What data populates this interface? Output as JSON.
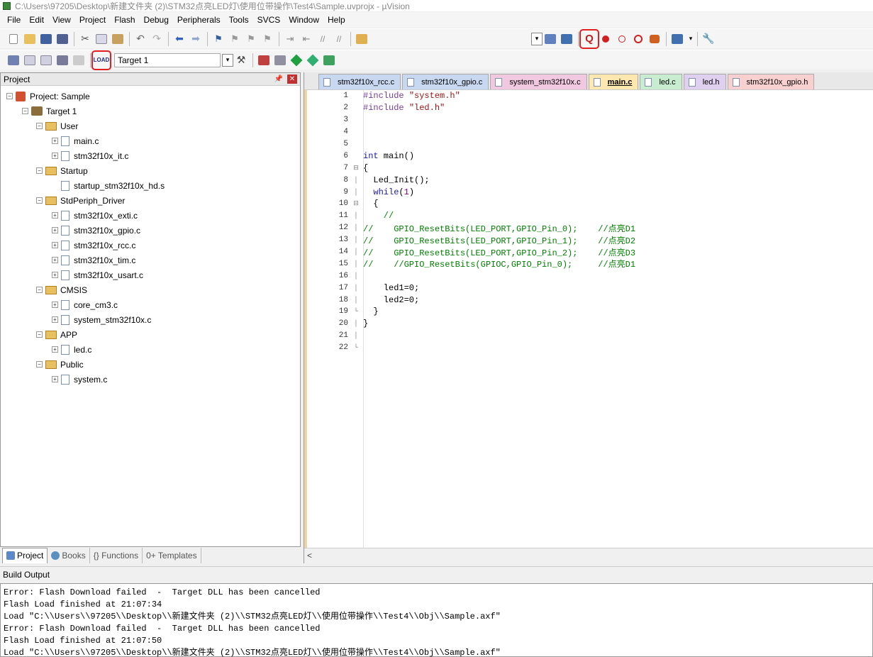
{
  "title": "C:\\Users\\97205\\Desktop\\新建文件夹 (2)\\STM32点亮LED灯\\使用位带操作\\Test4\\Sample.uvprojx - µVision",
  "menu": [
    "File",
    "Edit",
    "View",
    "Project",
    "Flash",
    "Debug",
    "Peripherals",
    "Tools",
    "SVCS",
    "Window",
    "Help"
  ],
  "toolbar2": {
    "target": "Target 1"
  },
  "colors": {
    "highlight": "#e02020",
    "active_tab": "#ffe8b0",
    "comment": "#008000",
    "keyword": "#1a1aa6",
    "string": "#a31515"
  },
  "project": {
    "header": "Project",
    "root": "Project: Sample",
    "target": "Target 1",
    "groups": [
      {
        "name": "User",
        "files": [
          "main.c",
          "stm32f10x_it.c"
        ]
      },
      {
        "name": "Startup",
        "files": [
          "startup_stm32f10x_hd.s"
        ]
      },
      {
        "name": "StdPeriph_Driver",
        "files": [
          "stm32f10x_exti.c",
          "stm32f10x_gpio.c",
          "stm32f10x_rcc.c",
          "stm32f10x_tim.c",
          "stm32f10x_usart.c"
        ]
      },
      {
        "name": "CMSIS",
        "files": [
          "core_cm3.c",
          "system_stm32f10x.c"
        ]
      },
      {
        "name": "APP",
        "files": [
          "led.c"
        ]
      },
      {
        "name": "Public",
        "files": [
          "system.c"
        ]
      }
    ],
    "tabs": [
      "Project",
      "Books",
      "{} Functions",
      "0+ Templates"
    ]
  },
  "editor": {
    "tabs": [
      {
        "label": "stm32f10x_rcc.c",
        "color": "#c8d8f0",
        "active": false
      },
      {
        "label": "stm32f10x_gpio.c",
        "color": "#c8d8f0",
        "active": false
      },
      {
        "label": "system_stm32f10x.c",
        "color": "#f0c8e0",
        "active": false
      },
      {
        "label": "main.c",
        "color": "#ffe8b0",
        "active": true
      },
      {
        "label": "led.c",
        "color": "#c8ecd0",
        "active": false
      },
      {
        "label": "led.h",
        "color": "#e0d0f0",
        "active": false
      },
      {
        "label": "stm32f10x_gpio.h",
        "color": "#f8d0d0",
        "active": false
      }
    ],
    "lines": [
      {
        "n": "1",
        "fold": "",
        "code": "#include \"system.h\""
      },
      {
        "n": "2",
        "fold": "",
        "code": "#include \"led.h\""
      },
      {
        "n": "3",
        "fold": "",
        "code": ""
      },
      {
        "n": "4",
        "fold": "",
        "code": ""
      },
      {
        "n": "5",
        "fold": "",
        "code": ""
      },
      {
        "n": "6",
        "fold": "",
        "code": "int main()"
      },
      {
        "n": "7",
        "fold": "⊟",
        "code": "{"
      },
      {
        "n": "8",
        "fold": "│",
        "code": "  Led_Init();"
      },
      {
        "n": "9",
        "fold": "│",
        "code": "  while(1)"
      },
      {
        "n": "10",
        "fold": "⊟",
        "code": "  {"
      },
      {
        "n": "11",
        "fold": "│",
        "code": "    //"
      },
      {
        "n": "12",
        "fold": "│",
        "code": "//    GPIO_ResetBits(LED_PORT,GPIO_Pin_0);    //点亮D1"
      },
      {
        "n": "13",
        "fold": "│",
        "code": "//    GPIO_ResetBits(LED_PORT,GPIO_Pin_1);    //点亮D2"
      },
      {
        "n": "14",
        "fold": "│",
        "code": "//    GPIO_ResetBits(LED_PORT,GPIO_Pin_2);    //点亮D3"
      },
      {
        "n": "15",
        "fold": "│",
        "code": "//    //GPIO_ResetBits(GPIOC,GPIO_Pin_0);     //点亮D1"
      },
      {
        "n": "16",
        "fold": "│",
        "code": ""
      },
      {
        "n": "17",
        "fold": "│",
        "code": "    led1=0;"
      },
      {
        "n": "18",
        "fold": "│",
        "code": "    led2=0;"
      },
      {
        "n": "19",
        "fold": "└",
        "code": "  }"
      },
      {
        "n": "20",
        "fold": "│",
        "code": "}"
      },
      {
        "n": "21",
        "fold": "│",
        "code": ""
      },
      {
        "n": "22",
        "fold": "└",
        "code": ""
      }
    ]
  },
  "build": {
    "header": "Build Output",
    "lines": [
      "Error: Flash Download failed  -  Target DLL has been cancelled",
      "Flash Load finished at 21:07:34",
      "Load \"C:\\\\Users\\\\97205\\\\Desktop\\\\新建文件夹 (2)\\\\STM32点亮LED灯\\\\使用位带操作\\\\Test4\\\\Obj\\\\Sample.axf\"",
      "Error: Flash Download failed  -  Target DLL has been cancelled",
      "Flash Load finished at 21:07:50",
      "Load \"C:\\\\Users\\\\97205\\\\Desktop\\\\新建文件夹 (2)\\\\STM32点亮LED灯\\\\使用位带操作\\\\Test4\\\\Obj\\\\Sample.axf\""
    ]
  }
}
